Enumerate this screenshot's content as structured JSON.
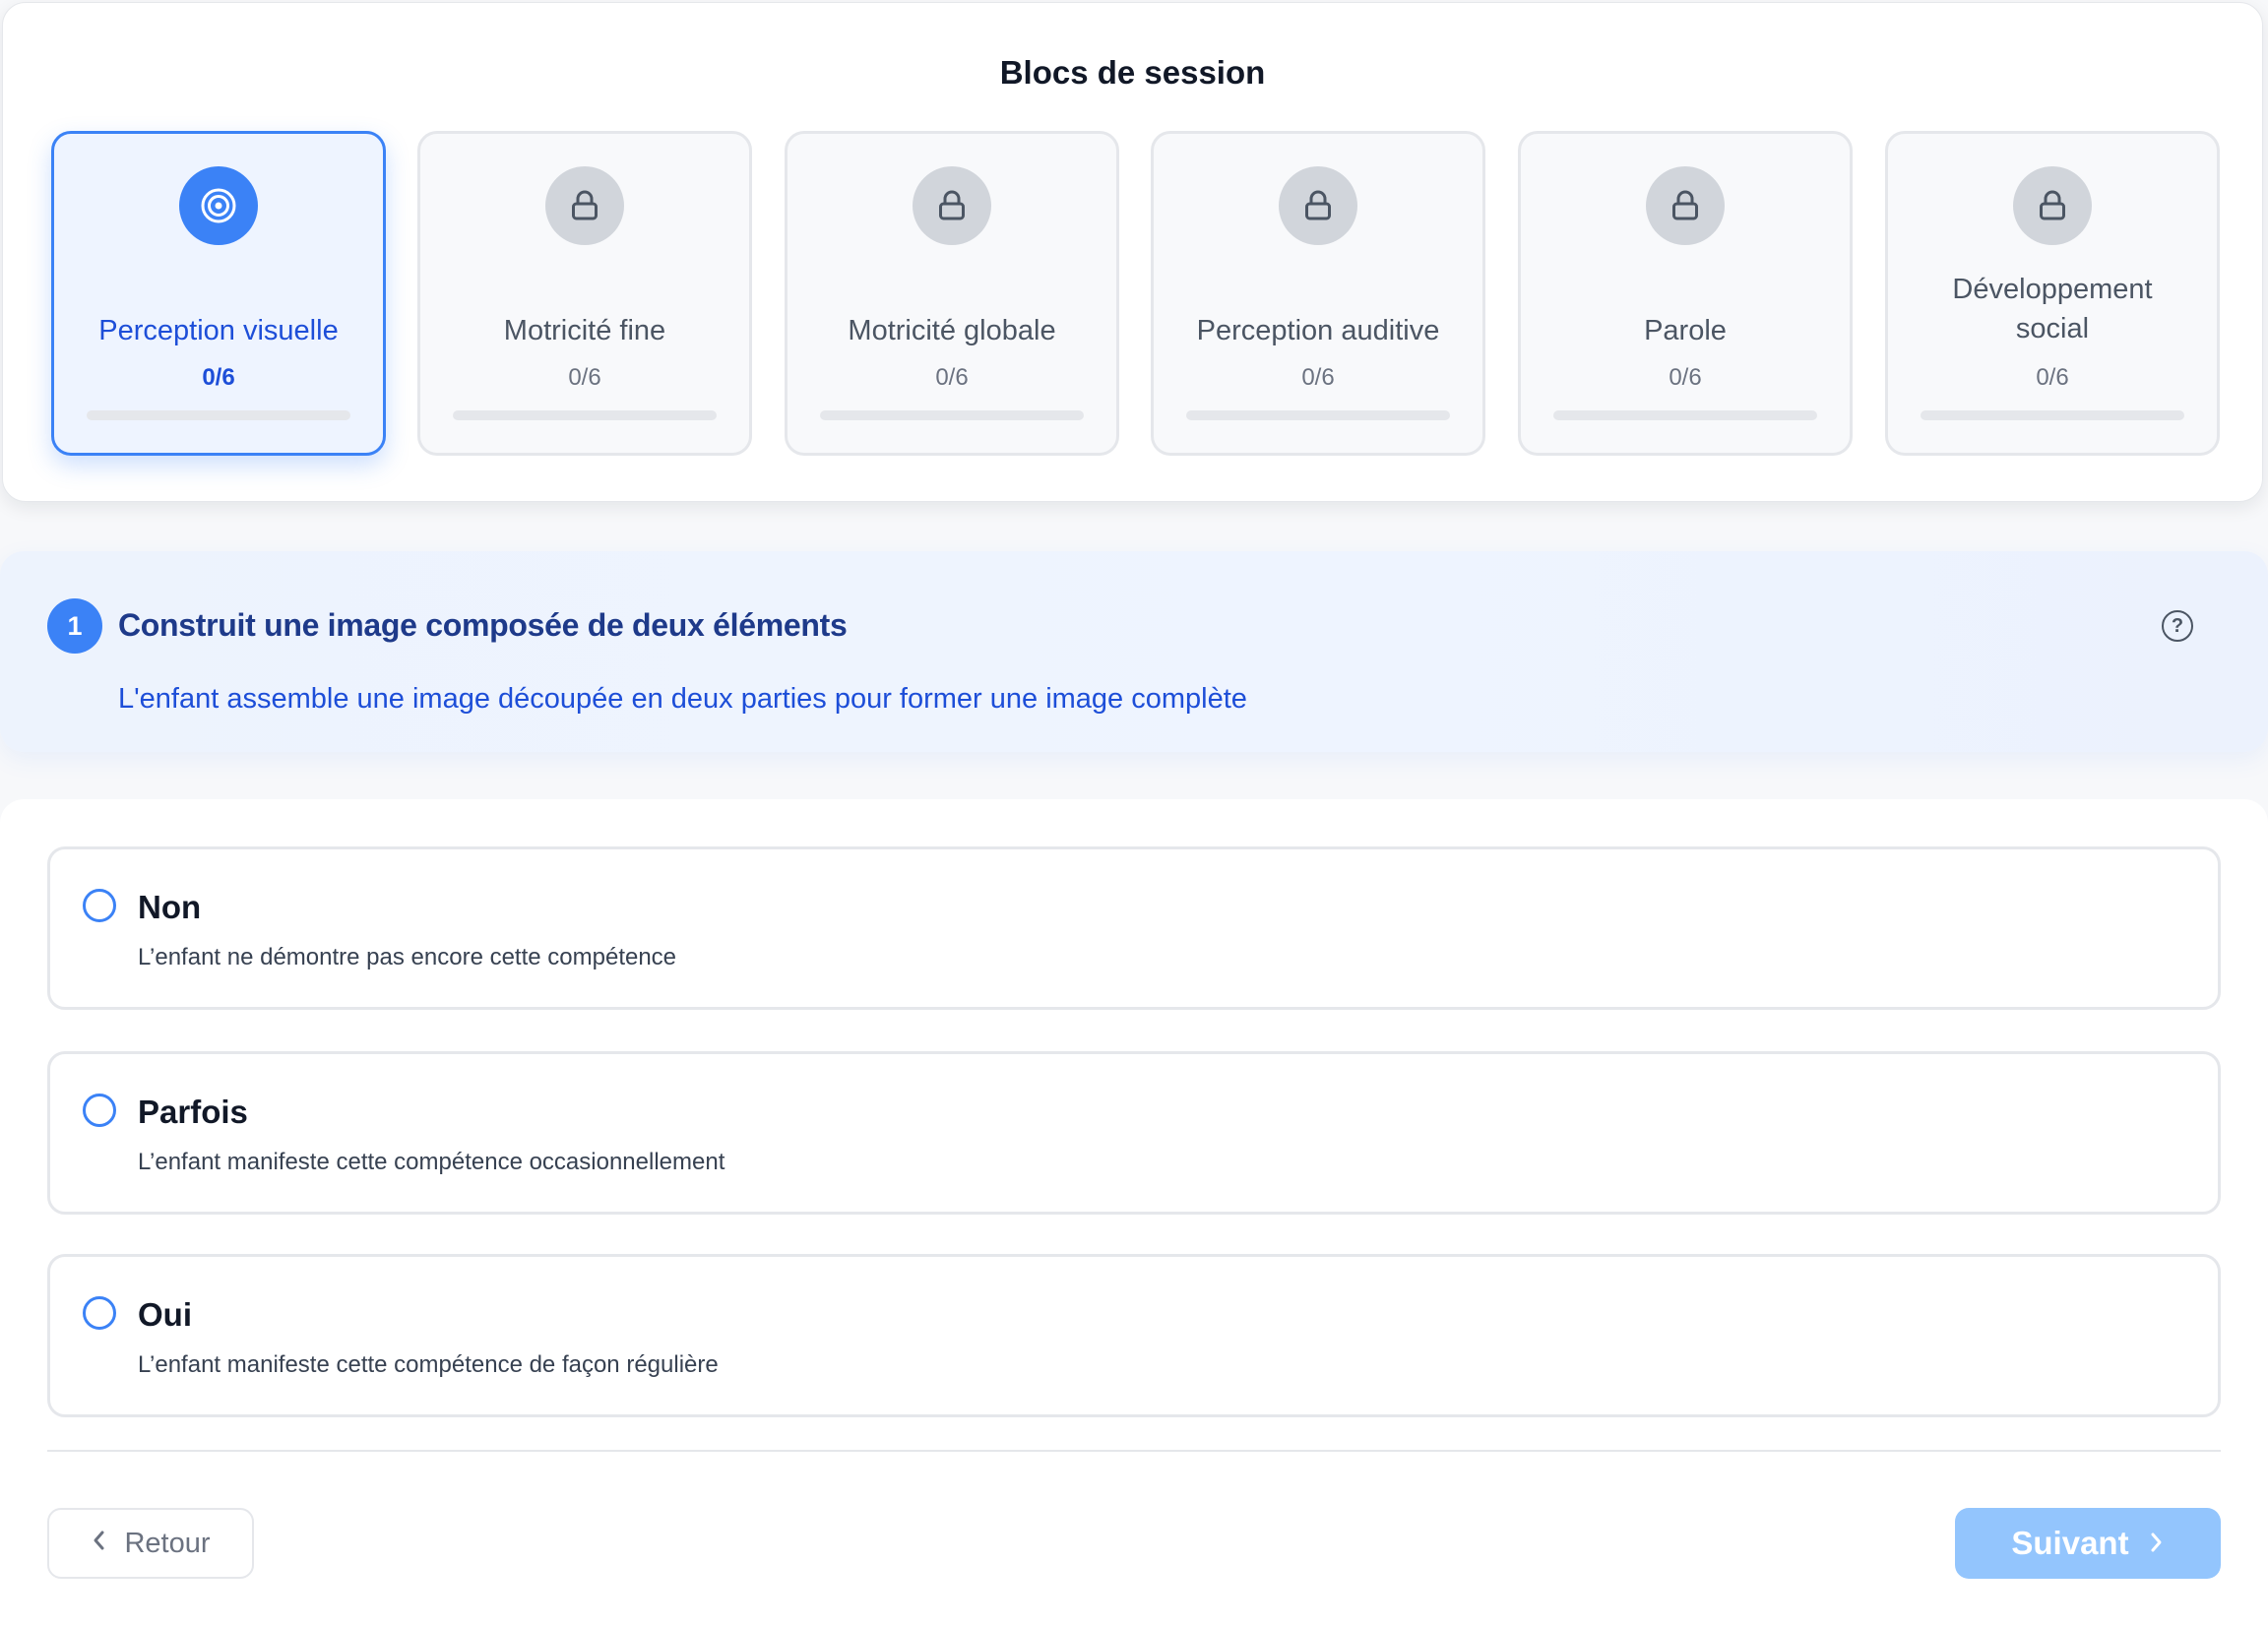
{
  "blocks_section": {
    "title": "Blocs de session",
    "blocks": [
      {
        "label": "Perception visuelle",
        "count": "0/6",
        "progress": 0,
        "active": true,
        "icon": "target-icon"
      },
      {
        "label": "Motricité fine",
        "count": "0/6",
        "progress": 0,
        "active": false,
        "icon": "lock-icon"
      },
      {
        "label": "Motricité globale",
        "count": "0/6",
        "progress": 0,
        "active": false,
        "icon": "lock-icon"
      },
      {
        "label": "Perception auditive",
        "count": "0/6",
        "progress": 0,
        "active": false,
        "icon": "lock-icon"
      },
      {
        "label": "Parole",
        "count": "0/6",
        "progress": 0,
        "active": false,
        "icon": "lock-icon"
      },
      {
        "label": "Développement social",
        "count": "0/6",
        "progress": 0,
        "active": false,
        "icon": "lock-icon"
      }
    ]
  },
  "question": {
    "number": "1",
    "title": "Construit une image composée de deux éléments",
    "description": "L'enfant assemble une image découpée en deux parties pour former une image complète",
    "help_icon": "question-circle-icon"
  },
  "options": [
    {
      "label": "Non",
      "description": "L’enfant ne démontre pas encore cette compétence"
    },
    {
      "label": "Parfois",
      "description": "L’enfant manifeste cette compétence occasionnellement"
    },
    {
      "label": "Oui",
      "description": "L’enfant manifeste cette compétence de façon régulière"
    }
  ],
  "navigation": {
    "back_label": "Retour",
    "next_label": "Suivant"
  },
  "colors": {
    "accent": "#3b82f6",
    "accent_dark": "#1d4ed8",
    "title_navy": "#1e3a8a",
    "next_disabled": "#93c5fd",
    "locked_badge": "#d1d5db"
  }
}
